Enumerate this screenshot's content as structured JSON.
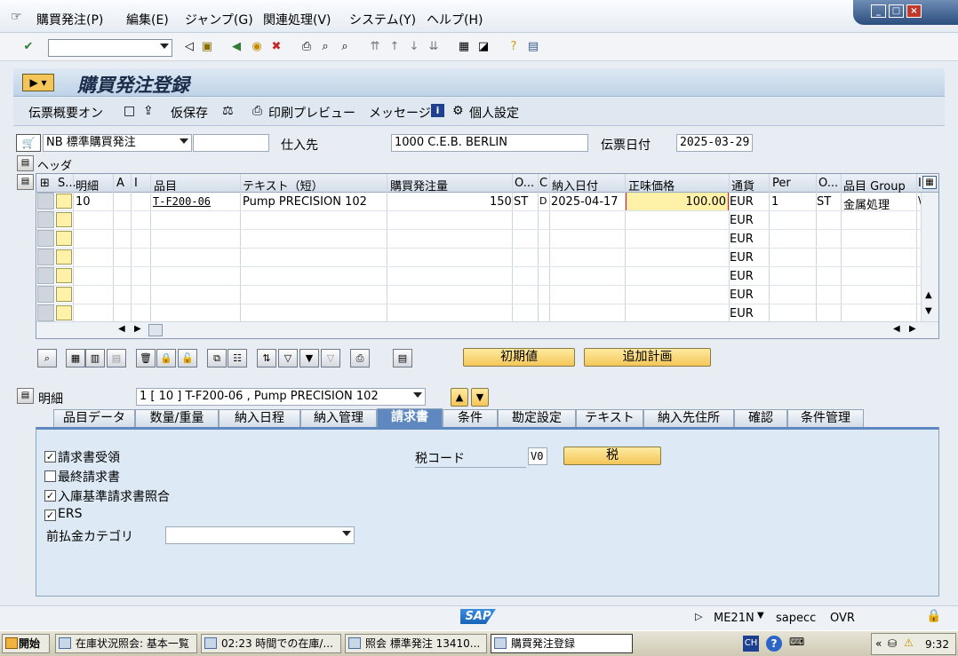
{
  "menu": [
    "購買発注(P)",
    "編集(E)",
    "ジャンプ(G)",
    "関連処理(V)",
    "システム(Y)",
    "ヘルプ(H)"
  ],
  "window_controls": {
    "minimize": "_",
    "restore": "□",
    "close": "×"
  },
  "toolbar": {
    "command_field": ""
  },
  "title": "購買発注登録",
  "appbar": {
    "overview": "伝票概要オン",
    "hold": "仮保存",
    "print_preview": "印刷プレビュー",
    "messages": "メッセージ",
    "personal": "個人設定"
  },
  "header": {
    "doc_type": "NB 標準購買発注",
    "doc_number": "",
    "vendor_label": "仕入先",
    "vendor": "1000 C.E.B. BERLIN",
    "doc_date_label": "伝票日付",
    "doc_date": "2025-03-29",
    "header_toggle": "ヘッダ"
  },
  "grid": {
    "columns": [
      "S...",
      "明細",
      "A",
      "I",
      "品目",
      "テキスト（短）",
      "購買発注量",
      "O...",
      "C",
      "納入日付",
      "正味価格",
      "通貨",
      "Per",
      "O...",
      "品目 Group",
      "I"
    ],
    "rows": [
      {
        "item": "10",
        "material": "T-F200-06",
        "text": "Pump PRECISION 102",
        "qty": "150",
        "uom": "ST",
        "cat": "D",
        "date": "2025-04-17",
        "price": "100.00",
        "curr": "EUR",
        "per": "1",
        "opu": "ST",
        "group": "金属処理",
        "i": "\\"
      },
      {
        "curr": "EUR"
      },
      {
        "curr": "EUR"
      },
      {
        "curr": "EUR"
      },
      {
        "curr": "EUR"
      },
      {
        "curr": "EUR"
      },
      {
        "curr": "EUR"
      }
    ]
  },
  "buttons": {
    "default_values": "初期値",
    "add_planning": "追加計画"
  },
  "item_detail": {
    "label": "明細",
    "selected": "1 [ 10 ] T-F200-06 , Pump PRECISION 102"
  },
  "tabs": [
    "品目データ",
    "数量/重量",
    "納入日程",
    "納入管理",
    "請求書",
    "条件",
    "勘定設定",
    "テキスト",
    "納入先住所",
    "確認",
    "条件管理"
  ],
  "active_tab": "請求書",
  "invoice_tab": {
    "inv_receipt": {
      "label": "請求書受領",
      "checked": true
    },
    "final_invoice": {
      "label": "最終請求書",
      "checked": false
    },
    "gr_based_iv": {
      "label": "入庫基準請求書照合",
      "checked": true
    },
    "ers": {
      "label": "ERS",
      "checked": true
    },
    "dp_category_label": "前払金カテゴリ",
    "dp_category": "",
    "tax_code_label": "税コード",
    "tax_code": "V0",
    "tax_button": "税"
  },
  "status": {
    "logo": "SAP",
    "tcode": "ME21N",
    "server": "sapecc",
    "mode": "OVR"
  },
  "taskbar": {
    "start": "開始",
    "tasks": [
      "在庫状況照会: 基本一覧",
      "02:23 時間での在庫/...",
      "照会 標準発注 13410...",
      "購買発注登録"
    ],
    "ime": "CH",
    "clock": "9:32"
  },
  "colors": {
    "accent": "#5f88c0",
    "input_highlight": "#fff2a8",
    "button_yellow": "#f4c659"
  }
}
